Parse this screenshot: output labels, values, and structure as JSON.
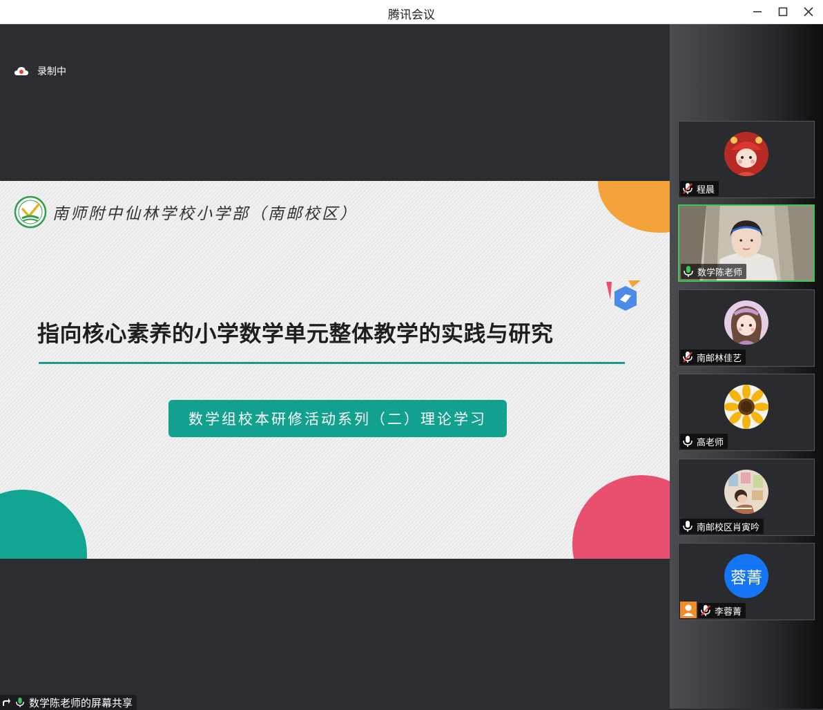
{
  "window": {
    "title": "腾讯会议"
  },
  "recording": {
    "label": "录制中"
  },
  "slide": {
    "school_name": "南师附中仙林学校小学部（南邮校区）",
    "title": "指向核心素养的小学数学单元整体教学的实践与研究",
    "subtitle": "数学组校本研修活动系列（二）理论学习"
  },
  "share": {
    "label": "数学陈老师的屏幕共享"
  },
  "participants": [
    {
      "name": "程晨",
      "mic": "muted",
      "avatar": "red-costume-child-avatar"
    },
    {
      "name": "数学陈老师",
      "mic": "on",
      "avatar": "live-video",
      "active_speaker": true
    },
    {
      "name": "南邮林佳艺",
      "mic": "muted",
      "avatar": "cartoon-girl-avatar"
    },
    {
      "name": "高老师",
      "mic": "on",
      "avatar": "sunflower-avatar"
    },
    {
      "name": "南邮校区肖寅吟",
      "mic": "on",
      "avatar": "child-photo-avatar"
    },
    {
      "name": "李蓉菁",
      "mic": "muted",
      "avatar": "initials",
      "initials": "蓉菁",
      "host": true
    }
  ],
  "colors": {
    "accent_green": "#3cc35a",
    "teal": "#12a08f",
    "orange": "#f3a33a",
    "pink": "#e9506f",
    "initials_blue": "#1576f5"
  }
}
